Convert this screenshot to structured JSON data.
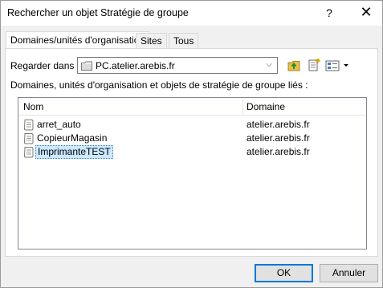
{
  "window": {
    "title": "Rechercher un objet Stratégie de groupe",
    "help_glyph": "?",
    "close_glyph": "✕"
  },
  "tabs": [
    {
      "label": "Domaines/unités d'organisation",
      "active": true
    },
    {
      "label": "Sites",
      "active": false
    },
    {
      "label": "Tous",
      "active": false
    }
  ],
  "lookin": {
    "label": "Regarder dans :",
    "value": "PC.atelier.arebis.fr",
    "arrow": "⌵"
  },
  "list_label": "Domaines, unités d'organisation et objets de stratégie de groupe liés :",
  "columns": {
    "name": "Nom",
    "domain": "Domaine"
  },
  "rows": [
    {
      "name": "arret_auto",
      "domain": "atelier.arebis.fr",
      "selected": false
    },
    {
      "name": "CopieurMagasin",
      "domain": "atelier.arebis.fr",
      "selected": false
    },
    {
      "name": "ImprimanteTEST",
      "domain": "atelier.arebis.fr",
      "selected": true
    }
  ],
  "buttons": {
    "ok": "OK",
    "cancel": "Annuler"
  },
  "icons": {
    "toolbar": [
      "up-folder-icon",
      "new-gpo-icon",
      "view-options-icon"
    ],
    "row": "gpo-scroll-icon"
  },
  "colors": {
    "selection": "#cce8ff",
    "default_button_border": "#0078d7"
  }
}
